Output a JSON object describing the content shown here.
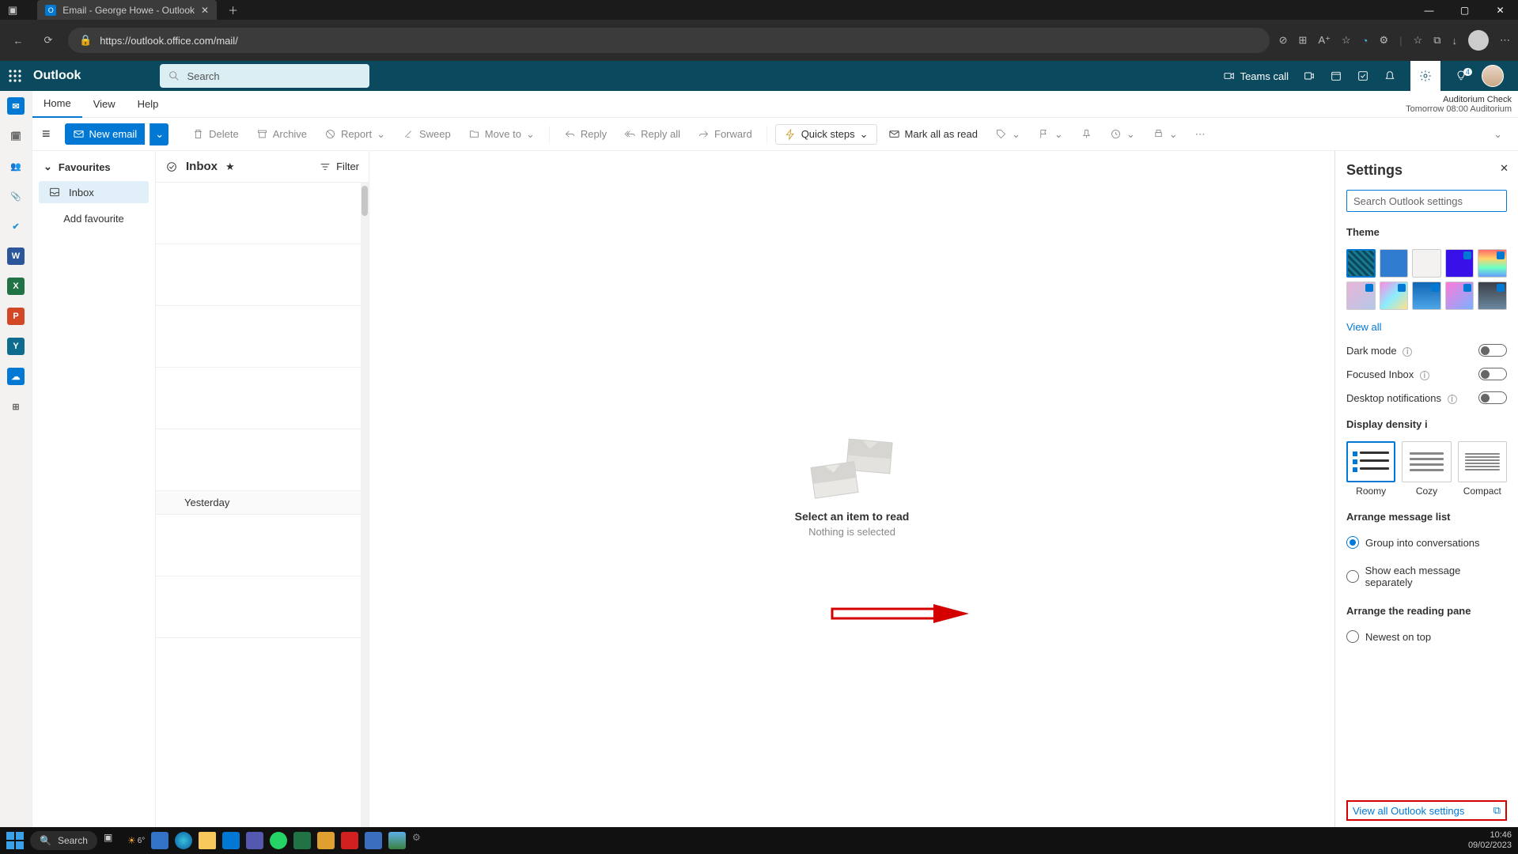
{
  "browser": {
    "tab_title": "Email - George Howe - Outlook",
    "url": "https://outlook.office.com/mail/"
  },
  "suite": {
    "brand": "Outlook",
    "search_placeholder": "Search",
    "teams_call": "Teams call",
    "tips_badge": "4"
  },
  "notification": {
    "title": "Auditorium Check",
    "time": "Tomorrow 08:00 Auditorium"
  },
  "tabs": {
    "home": "Home",
    "view": "View",
    "help": "Help"
  },
  "toolbar": {
    "hamburger": "≡",
    "new_email": "New email",
    "delete": "Delete",
    "archive": "Archive",
    "report": "Report",
    "sweep": "Sweep",
    "move_to": "Move to",
    "reply": "Reply",
    "reply_all": "Reply all",
    "forward": "Forward",
    "quick_steps": "Quick steps",
    "mark_all_read": "Mark all as read"
  },
  "nav": {
    "favourites": "Favourites",
    "inbox": "Inbox",
    "add_fav": "Add favourite"
  },
  "list": {
    "folder": "Inbox",
    "filter": "Filter",
    "section_yesterday": "Yesterday"
  },
  "reading": {
    "title": "Select an item to read",
    "subtitle": "Nothing is selected"
  },
  "settings": {
    "title": "Settings",
    "search_placeholder": "Search Outlook settings",
    "theme": "Theme",
    "view_all": "View all",
    "dark_mode": "Dark mode",
    "focused_inbox": "Focused Inbox",
    "desktop_notifications": "Desktop notifications",
    "display_density": "Display density",
    "density": {
      "roomy": "Roomy",
      "cozy": "Cozy",
      "compact": "Compact"
    },
    "arrange_list": "Arrange message list",
    "group_conv": "Group into conversations",
    "show_sep": "Show each message separately",
    "arrange_reading": "Arrange the reading pane",
    "newest_top": "Newest on top",
    "view_all_outlook": "View all Outlook settings"
  },
  "taskbar": {
    "search": "Search",
    "time": "10:46",
    "date": "09/02/2023",
    "weather": "6°"
  }
}
